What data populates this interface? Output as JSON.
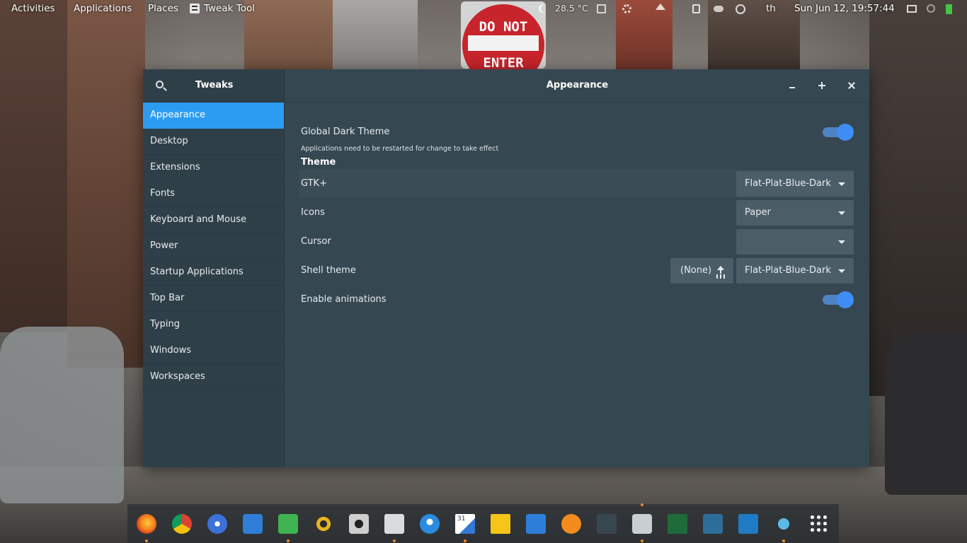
{
  "background": {
    "stop_sign_line1": "DO NOT",
    "stop_sign_line2": "ENTER"
  },
  "topbar": {
    "activities": "Activities",
    "applications": "Applications",
    "places": "Places",
    "app_name": "Tweak Tool",
    "weather": "28.5 °C",
    "language": "th",
    "clock": "Sun Jun 12, 19:57:44"
  },
  "sidebar": {
    "title": "Tweaks",
    "items": [
      {
        "label": "Appearance"
      },
      {
        "label": "Desktop"
      },
      {
        "label": "Extensions"
      },
      {
        "label": "Fonts"
      },
      {
        "label": "Keyboard and Mouse"
      },
      {
        "label": "Power"
      },
      {
        "label": "Startup Applications"
      },
      {
        "label": "Top Bar"
      },
      {
        "label": "Typing"
      },
      {
        "label": "Windows"
      },
      {
        "label": "Workspaces"
      }
    ]
  },
  "main": {
    "title": "Appearance",
    "global_dark": {
      "label": "Global Dark Theme",
      "note": "Applications need to be restarted for change to take effect",
      "enabled": true
    },
    "theme_section": "Theme",
    "gtk": {
      "label": "GTK+",
      "value": "Flat-Plat-Blue-Dark"
    },
    "icons": {
      "label": "Icons",
      "value": "Paper"
    },
    "cursor": {
      "label": "Cursor",
      "value": ""
    },
    "shell": {
      "label": "Shell theme",
      "upload_label": "(None)",
      "value": "Flat-Plat-Blue-Dark"
    },
    "animations": {
      "label": "Enable animations",
      "enabled": true
    }
  },
  "colors": {
    "accent": "#2c9cf2",
    "switch_on": "#3f8ef5",
    "window_bg": "#354751",
    "sidebar_bg": "#2f3f48"
  },
  "dock": {
    "icons": [
      "firefox-icon",
      "chrome-icon",
      "safari-compass-icon",
      "messaging-icon",
      "hashtag-icon",
      "music-player-icon",
      "camera-icon",
      "files-icon",
      "bird-icon",
      "calendar-icon",
      "sticky-notes-icon",
      "tasks-check-icon",
      "sync-icon",
      "terminal-icon",
      "tweaks-icon",
      "system-monitor-icon",
      "mysql-workbench-icon",
      "vscode-icon",
      "shotwell-icon",
      "app-grid-icon"
    ],
    "calendar_day": "31"
  }
}
